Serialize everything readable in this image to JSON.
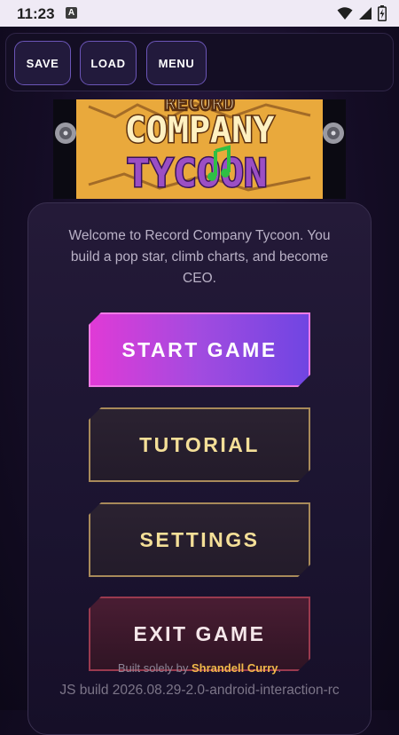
{
  "status_bar": {
    "time": "11:23",
    "notification_icon": "a-letter-icon",
    "wifi_icon": "wifi-icon",
    "signal_icon": "signal-icon",
    "battery_icon": "battery-charging-icon"
  },
  "toolbar": {
    "save_label": "SAVE",
    "load_label": "LOAD",
    "menu_label": "MENU"
  },
  "logo": {
    "line1": "COMPANY",
    "line2": "TYCOON",
    "partial_top": "RECORD"
  },
  "welcome_text": "Welcome to Record Company Tycoon. You build a pop star, climb charts, and become CEO.",
  "menu": {
    "start_label": "START GAME",
    "tutorial_label": "TUTORIAL",
    "settings_label": "SETTINGS",
    "exit_label": "EXIT GAME"
  },
  "footer": {
    "credit_prefix": "Built solely by ",
    "credit_author": "Shrandell Curry",
    "credit_suffix": ".",
    "build": "JS build 2026.08.29-2.0-android-interaction-rc"
  },
  "colors": {
    "accent_gold": "#f4df98",
    "start_gradient_left": "#e13ad6",
    "start_gradient_right": "#6f45e2",
    "author_orange": "#f0b84a"
  }
}
